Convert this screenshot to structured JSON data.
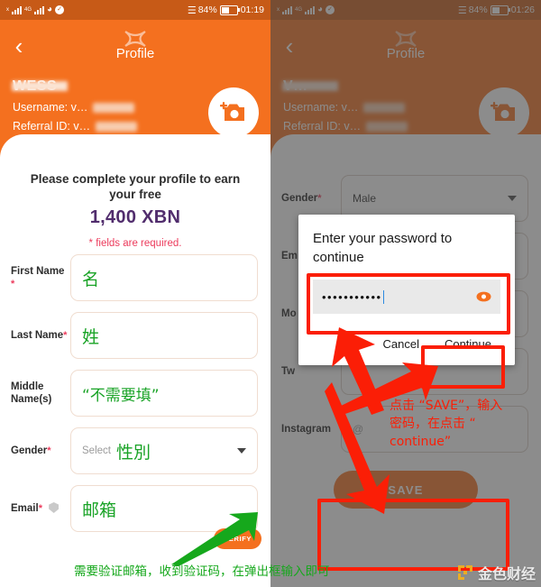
{
  "left_phone": {
    "status_bar": {
      "battery_text": "84%",
      "time": "01:19"
    },
    "app_bar": {
      "title": "Profile",
      "back_icon": "chevron-left-icon",
      "logo_icon": "butterfly-x-logo"
    },
    "profile_card": {
      "display_name_redacted": "WESS",
      "username_label": "Username:",
      "username_value_redacted": "v…",
      "referral_label": "Referral ID:",
      "referral_value_redacted": "v…",
      "camera_icon": "add-photo-camera-icon"
    },
    "promo": {
      "headline": "Please complete your profile to earn your free",
      "amount": "1,400 XBN",
      "required_note": "* fields are required."
    },
    "fields": [
      {
        "label": "First Name",
        "required": true,
        "value": "",
        "annotation_zh": "名"
      },
      {
        "label": "Last Name",
        "required": true,
        "value": "",
        "annotation_zh": "姓"
      },
      {
        "label": "Middle Name(s)",
        "required": false,
        "value": "",
        "annotation_zh": "“不需要填”"
      },
      {
        "label": "Gender",
        "required": true,
        "placeholder": "Select",
        "annotation_zh": "性別"
      },
      {
        "label": "Email",
        "required": true,
        "value": "",
        "annotation_zh": "邮箱",
        "action_label": "VERIFY"
      }
    ]
  },
  "right_phone": {
    "status_bar": {
      "battery_text": "84%",
      "time": "01:26"
    },
    "app_bar": {
      "title": "Profile",
      "back_icon": "chevron-left-icon",
      "logo_icon": "butterfly-x-logo"
    },
    "profile_card": {
      "display_name_redacted": "V…",
      "username_label": "Username:",
      "username_value_redacted": "v…",
      "referral_label": "Referral ID:",
      "referral_value_redacted": "v…",
      "camera_icon": "add-photo-camera-icon"
    },
    "fields": [
      {
        "label": "Gender",
        "required": true,
        "value": "Male"
      },
      {
        "label": "Em",
        "required": false,
        "value": ""
      },
      {
        "label": "Mo",
        "required": false,
        "value": ""
      },
      {
        "label": "Tw",
        "required": false,
        "value": ""
      },
      {
        "label": "Instagram",
        "required": false,
        "value": ""
      }
    ],
    "save_button": "SAVE",
    "dialog": {
      "title": "Enter your password to continue",
      "password_dots": "•••••••••••",
      "reveal_icon": "eye-icon",
      "cancel_label": "Cancel",
      "continue_label": "Continue"
    }
  },
  "annotations": {
    "green_note": "需要验证邮箱，收到验证码，在弹出框输入即可",
    "red_note_line1": "点击 “SAVE”，输入",
    "red_note_line2": "密码，在点击 “",
    "red_note_line3": "continue”",
    "green_arrow": "green-arrow-icon",
    "red_arrow_to_field": "red-arrow-icon",
    "red_arrow_to_continue": "red-arrow-icon",
    "red_arrow_to_save": "red-arrow-icon",
    "highlight_color": "#fb1e06",
    "green_color": "#16a81c"
  },
  "watermark": {
    "text": "金色财经",
    "mark_icon": "jinse-finance-logo"
  },
  "theme": {
    "accent": "#f4701f",
    "status_bar": "#c75a17",
    "amount_color": "#512d6d",
    "required_color": "#ec3b5c"
  }
}
